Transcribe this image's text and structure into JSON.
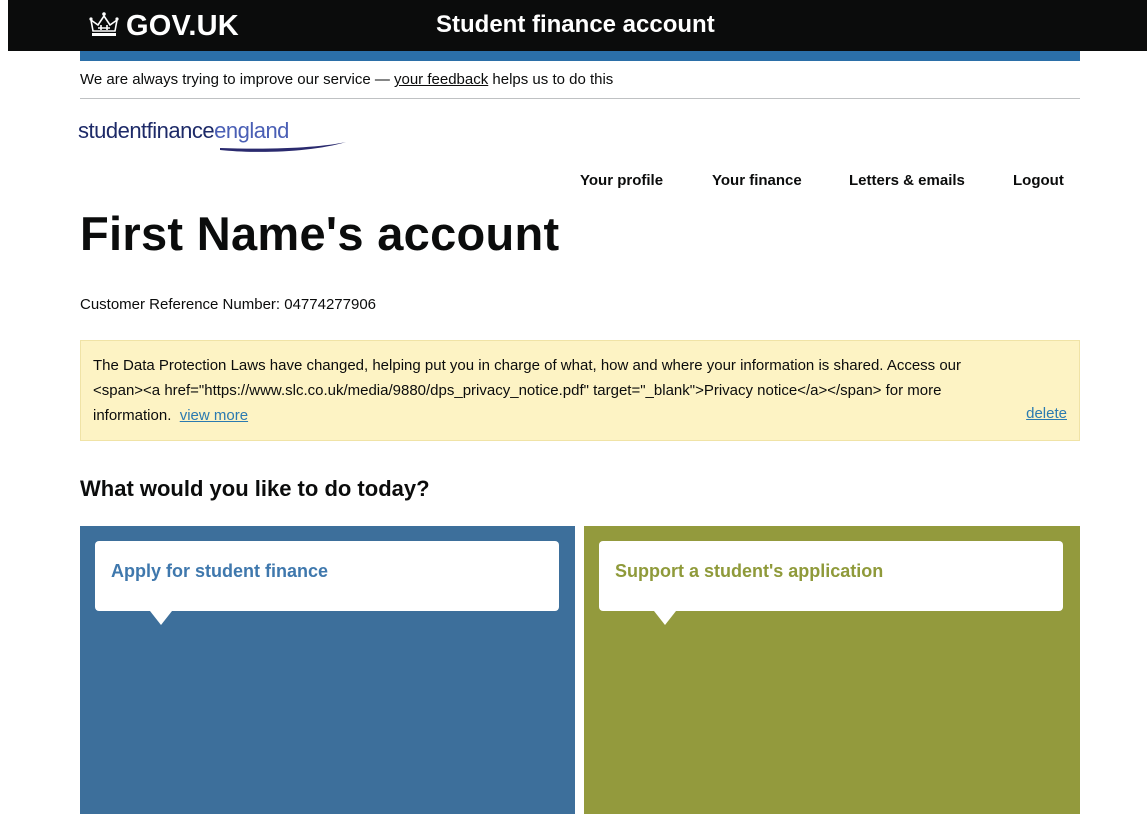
{
  "header": {
    "logo_text": "GOV.UK",
    "service_name": "Student finance account",
    "logo_icon": "crown-icon"
  },
  "feedback": {
    "prefix": "We are always trying to improve our service — ",
    "link": "your feedback",
    "suffix": " helps us to do this"
  },
  "brand": {
    "part1": "studentfinance",
    "part2": "england"
  },
  "nav": {
    "items": [
      "Your profile",
      "Your finance",
      "Letters & emails",
      "Logout"
    ]
  },
  "page": {
    "title": "First Name's account",
    "crn_label": "Customer Reference Number: ",
    "crn_value": "04774277906"
  },
  "notice": {
    "line1": "The Data Protection Laws have changed, helping put you in charge of what, how and where your information is shared. Access our",
    "line2": "<span><a href=\"https://www.slc.co.uk/media/9880/dps_privacy_notice.pdf\" target=\"_blank\">Privacy notice</a></span> for more",
    "line3": "information.",
    "view_more": "view more",
    "delete": "delete"
  },
  "section": {
    "heading": "What would you like to do today?"
  },
  "tiles": [
    {
      "label": "Apply for student finance",
      "color": "#3d6f9b"
    },
    {
      "label": "Support a student's application",
      "color": "#939a3d"
    }
  ],
  "colors": {
    "header_bg": "#0b0c0c",
    "blue_stripe": "#2b6fa8",
    "notice_bg": "#fdf3c4",
    "link": "#2b7ab0"
  }
}
